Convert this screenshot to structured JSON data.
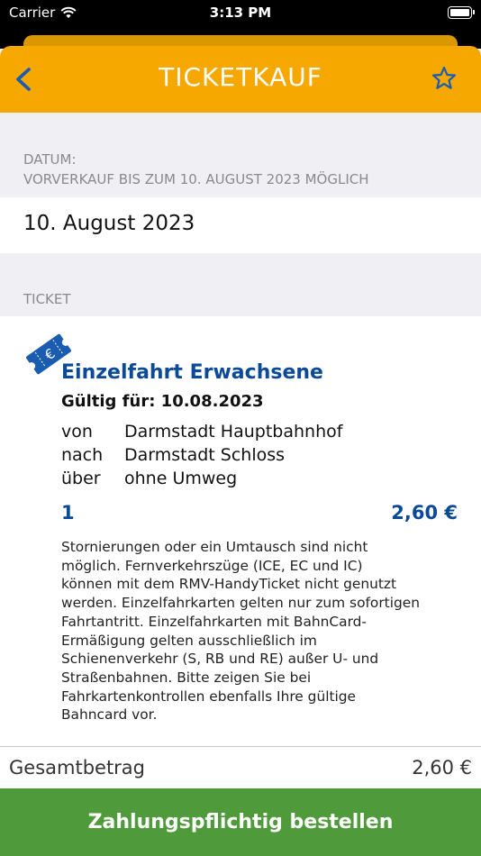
{
  "status_bar": {
    "carrier": "Carrier",
    "time": "3:13 PM"
  },
  "header": {
    "title": "TICKETKAUF"
  },
  "date_section": {
    "label": "DATUM:",
    "presale_note": "VORVERKAUF BIS ZUM 10. AUGUST 2023 MÖGLICH",
    "selected_date": "10. August 2023"
  },
  "ticket_section": {
    "label": "TICKET",
    "name": "Einzelfahrt Erwachsene",
    "valid_for": "Gültig für: 10.08.2023",
    "route": [
      {
        "key": "von",
        "value": "Darmstadt Hauptbahnhof"
      },
      {
        "key": "nach",
        "value": "Darmstadt Schloss"
      },
      {
        "key": "über",
        "value": "ohne Umweg"
      }
    ],
    "quantity": "1",
    "price": "2,60 €",
    "terms_lines": [
      "Stornierungen oder ein Umtausch sind nicht",
      "möglich. Fernverkehrszüge (ICE, EC und IC)",
      "können mit dem RMV-HandyTicket nicht genutzt",
      "werden. Einzelfahrkarten gelten nur zum sofortigen",
      "Fahrtantritt. Einzelfahrkarten mit BahnCard-",
      "Ermäßigung gelten ausschließlich im",
      "Schienenverkehr (S, RB und RE) außer U- und",
      "Straßenbahnen. Bitte zeigen Sie bei",
      "Fahrkartenkontrollen ebenfalls Ihre gültige",
      "Bahncard vor."
    ]
  },
  "total": {
    "label": "Gesamtbetrag",
    "amount": "2,60 €"
  },
  "order_button": {
    "label": "Zahlungspflichtig bestellen"
  },
  "icons": {
    "back": "chevron-left-icon",
    "favorite": "star-outline-icon",
    "ticket": "euro-ticket-icon",
    "wifi": "wifi-icon",
    "battery": "battery-icon"
  },
  "colors": {
    "brand_orange": "#f6a800",
    "brand_blue": "#0a4a99",
    "order_green": "#4f9b3b",
    "background": "#efeff4"
  }
}
